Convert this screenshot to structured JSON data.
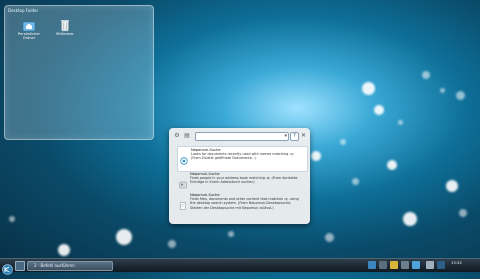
{
  "folder_view": {
    "title": "Desktop Folder",
    "icons": [
      {
        "label": "Persönlicher Ordner",
        "icon": "home-folder-icon"
      },
      {
        "label": "Mülleimer",
        "icon": "trash-icon"
      }
    ]
  },
  "krunner": {
    "query_value": "",
    "help_label": "?",
    "close_label": "✕",
    "results": [
      {
        "title": "Nepomuk-Suche",
        "desc": "Looks for documents recently used with names matching :q: (From Zuletzt geöffnete Dokumente...)",
        "icon": "search-result-icon"
      },
      {
        "title": "Nepomuk-Suche",
        "desc": "Finds people in your address book matching :q: (From Kontakte, Einträge in Ihrem Adressbuch suchen)",
        "icon": "contact-result-icon"
      },
      {
        "title": "Nepomuk-Suche",
        "desc": "Finds files, documents and other content that matches :q: using the desktop search system. (From Nepomuk-Desktopsuche, Starten der Desktopsuche mit Nepomuk zulässt.)",
        "icon": "document-result-icon"
      }
    ]
  },
  "taskbar": {
    "task_label": "2 - Befehl ausführen",
    "clock": "13:52"
  },
  "colors": {
    "accent": "#2b8fc2",
    "panel": "#1b2a35"
  }
}
